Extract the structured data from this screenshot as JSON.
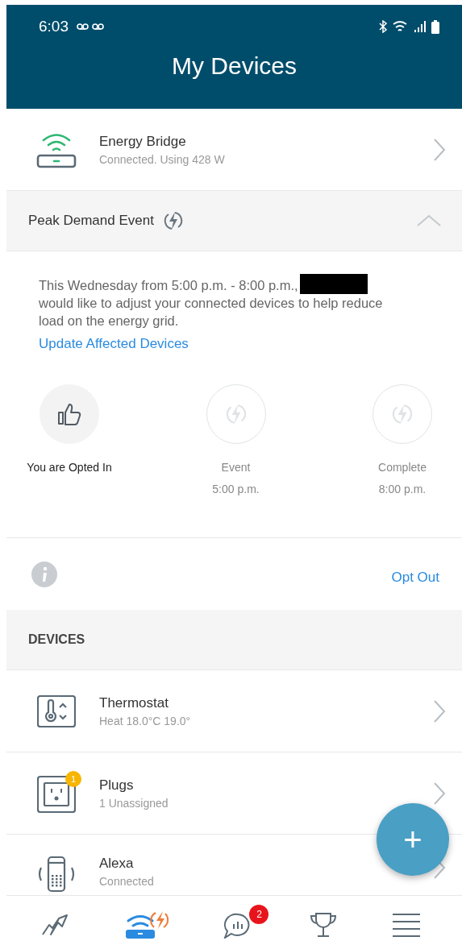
{
  "status_bar": {
    "time": "6:03"
  },
  "header": {
    "title": "My Devices"
  },
  "bridge": {
    "name": "Energy Bridge",
    "status": "Connected. Using 428 W"
  },
  "event": {
    "title": "Peak Demand Event",
    "expanded": true,
    "message": "This Wednesday from 5:00 p.m. - 8:00 p.m.,",
    "message_rest": "would like to adjust your connected devices to help reduce load on the energy grid.",
    "redacted": true,
    "link": "Update Affected Devices",
    "steps": [
      {
        "label": "You are Opted In",
        "active": true
      },
      {
        "label": "Event",
        "time": "5:00 p.m.",
        "active": false
      },
      {
        "label": "Complete",
        "time": "8:00 p.m.",
        "active": false
      }
    ],
    "action": "Opt Out"
  },
  "devices": {
    "heading": "DEVICES",
    "items": [
      {
        "name": "Thermostat",
        "status": "Heat 18.0°C  19.0°"
      },
      {
        "name": "Plugs",
        "status": "1 Unassigned",
        "badge": "1"
      },
      {
        "name": "Alexa",
        "status": "Connected"
      }
    ]
  },
  "fab": {
    "label": "+"
  },
  "nav": [
    {
      "selected": false
    },
    {
      "selected": true
    },
    {
      "selected": false,
      "badge": "2"
    },
    {
      "selected": false
    },
    {
      "selected": false
    }
  ]
}
